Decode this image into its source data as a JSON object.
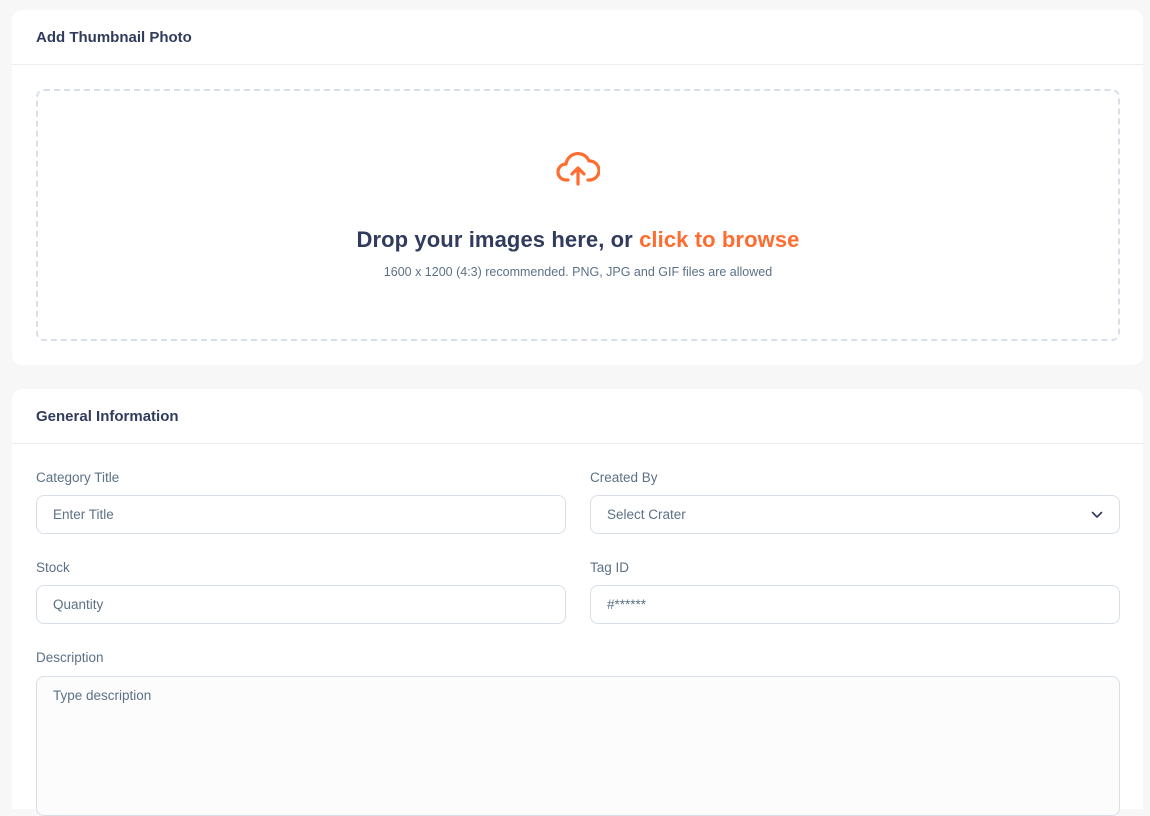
{
  "thumbnail_card": {
    "title": "Add Thumbnail Photo",
    "dropzone": {
      "icon": "cloud-upload-icon",
      "text_prefix": "Drop your images here, or ",
      "browse_link": "click to browse",
      "hint": "1600 x 1200 (4:3) recommended. PNG, JPG and GIF files are allowed"
    }
  },
  "general_card": {
    "title": "General Information",
    "category_title": {
      "label": "Category Title",
      "placeholder": "Enter Title"
    },
    "created_by": {
      "label": "Created By",
      "selected": "Select Crater"
    },
    "stock": {
      "label": "Stock",
      "placeholder": "Quantity"
    },
    "tag_id": {
      "label": "Tag ID",
      "placeholder": "#******"
    },
    "description": {
      "label": "Description",
      "placeholder": "Type description"
    }
  },
  "colors": {
    "accent": "#ff6c2f",
    "text": "#313b5e",
    "muted": "#5d7186",
    "border": "#d8dfe7"
  }
}
